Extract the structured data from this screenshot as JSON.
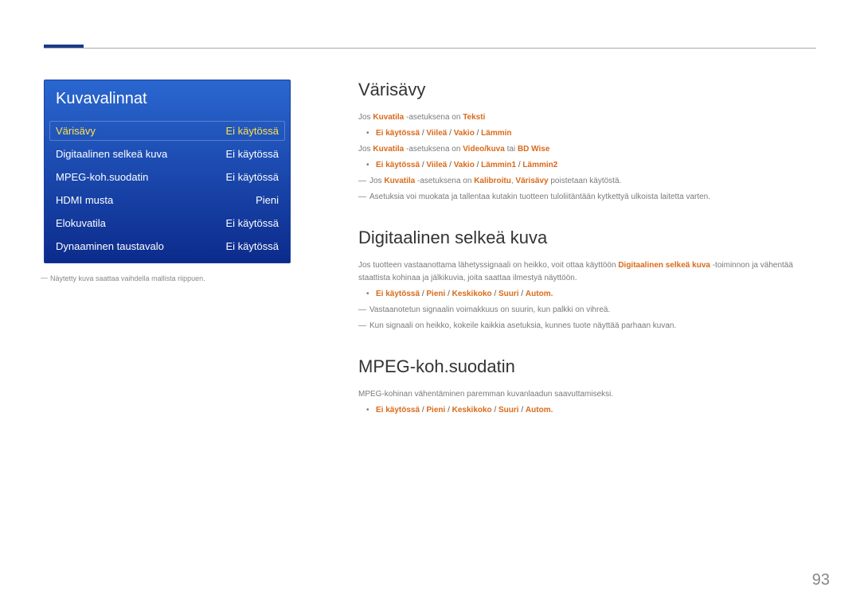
{
  "menu": {
    "title": "Kuvavalinnat",
    "rows": [
      {
        "label": "Värisävy",
        "value": "Ei käytössä",
        "selected": true
      },
      {
        "label": "Digitaalinen selkeä kuva",
        "value": "Ei käytössä",
        "selected": false
      },
      {
        "label": "MPEG-koh.suodatin",
        "value": "Ei käytössä",
        "selected": false
      },
      {
        "label": "HDMI musta",
        "value": "Pieni",
        "selected": false
      },
      {
        "label": "Elokuvatila",
        "value": "Ei käytössä",
        "selected": false
      },
      {
        "label": "Dynaaminen taustavalo",
        "value": "Ei käytössä",
        "selected": false
      }
    ],
    "footnote": "Näytetty kuva saattaa vaihdella mallista riippuen."
  },
  "sections": {
    "varisavy": {
      "title": "Värisävy",
      "line1_pre": "Jos ",
      "line1_kw1": "Kuvatila",
      "line1_mid": " -asetuksena on ",
      "line1_kw2": "Teksti",
      "opts1_o1": "Ei käytössä",
      "opts_sep": " / ",
      "opts1_o2": "Viileä",
      "opts1_o3": "Vakio",
      "opts1_o4": "Lämmin",
      "line2_pre": "Jos ",
      "line2_kw1": "Kuvatila",
      "line2_mid": " -asetuksena on ",
      "line2_kw2": "Video/kuva",
      "line2_or": " tai ",
      "line2_kw3": "BD Wise",
      "opts2_o1": "Ei käytössä",
      "opts2_o2": "Viileä",
      "opts2_o3": "Vakio",
      "opts2_o4": "Lämmin1",
      "opts2_o5": "Lämmin2",
      "note1_pre": "Jos ",
      "note1_kw1": "Kuvatila",
      "note1_mid": " -asetuksena on ",
      "note1_kw2": "Kalibroitu",
      "note1_comma": ", ",
      "note1_kw3": "Värisävy",
      "note1_post": " poistetaan käytöstä.",
      "note2": "Asetuksia voi muokata ja tallentaa kutakin tuotteen tuloliitäntään kytkettyä ulkoista laitetta varten."
    },
    "digitaalinen": {
      "title": "Digitaalinen selkeä kuva",
      "p_pre": "Jos tuotteen vastaanottama lähetyssignaali on heikko, voit ottaa käyttöön ",
      "p_kw": "Digitaalinen selkeä kuva",
      "p_post": " -toiminnon ja vähentää staattista kohinaa ja jälkikuvia, joita saattaa ilmestyä näyttöön.",
      "opts_o1": "Ei käytössä",
      "opts_o2": "Pieni",
      "opts_o3": "Keskikoko",
      "opts_o4": "Suuri",
      "opts_o5": "Autom.",
      "note1": "Vastaanotetun signaalin voimakkuus on suurin, kun palkki on vihreä.",
      "note2": "Kun signaali on heikko, kokeile kaikkia asetuksia, kunnes tuote näyttää parhaan kuvan."
    },
    "mpeg": {
      "title": "MPEG-koh.suodatin",
      "p": "MPEG-kohinan vähentäminen paremman kuvanlaadun saavuttamiseksi.",
      "opts_o1": "Ei käytössä",
      "opts_o2": "Pieni",
      "opts_o3": "Keskikoko",
      "opts_o4": "Suuri",
      "opts_o5": "Autom."
    }
  },
  "pageNumber": "93"
}
